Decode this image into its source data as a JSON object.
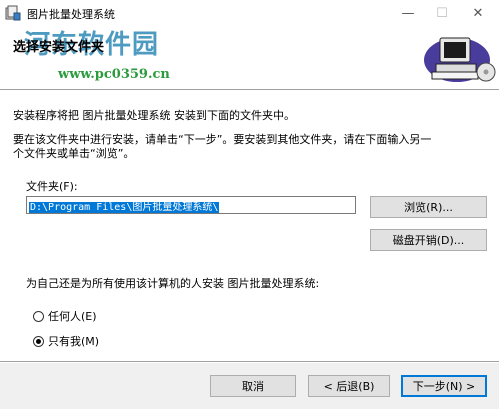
{
  "window": {
    "title": "图片批量处理系统",
    "buttons": {
      "minimize": "—",
      "maximize": "☐",
      "close": "✕"
    }
  },
  "header": {
    "title": "选择安装文件夹",
    "watermark": "河东软件园",
    "watermark_url": "www.pc0359.cn"
  },
  "body": {
    "intro": "安装程序将把 图片批量处理系统 安装到下面的文件夹中。",
    "instruction_line1": "要在该文件夹中进行安装，请单击“下一步”。要安装到其他文件夹，请在下面输入另一",
    "instruction_line2": "个文件夹或单击“浏览”。",
    "folder_label": "文件夹(F):",
    "folder_value": "D:\\Program Files\\图片批量处理系统\\",
    "browse_button": "浏览(R)...",
    "disk_cost_button": "磁盘开销(D)...",
    "install_for_question": "为自己还是为所有使用该计算机的人安装 图片批量处理系统:",
    "options": [
      {
        "label": "任何人(E)",
        "checked": false
      },
      {
        "label": "只有我(M)",
        "checked": true
      }
    ]
  },
  "footer": {
    "cancel_button": "取消",
    "back_button": "< 后退(B)",
    "next_button": "下一步(N) >"
  }
}
